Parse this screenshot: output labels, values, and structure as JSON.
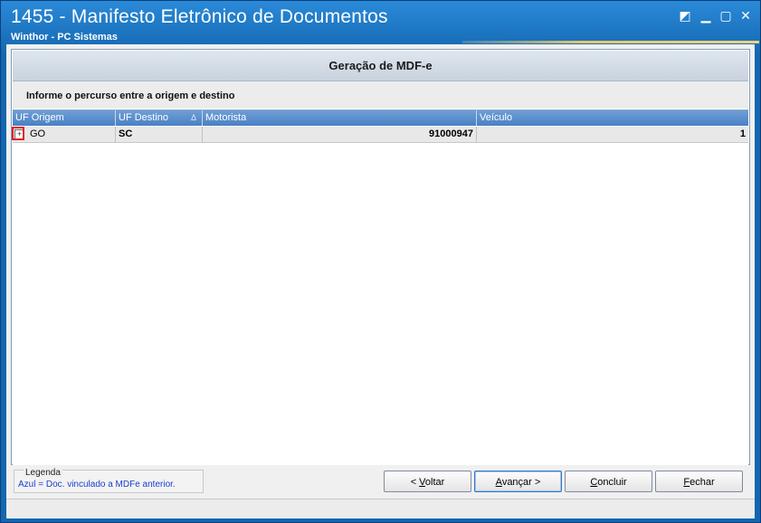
{
  "window": {
    "title": "1455 - Manifesto Eletrônico de Documentos",
    "subtitle": "Winthor - PC Sistemas",
    "controls": {
      "restore_glyph": "◩",
      "minimize_glyph": "▁",
      "maximize_glyph": "▢",
      "close_glyph": "✕"
    }
  },
  "panel": {
    "title": "Geração de MDF-e",
    "instruction": "Informe o percurso entre a origem e destino"
  },
  "grid": {
    "columns": [
      "UF Origem",
      "UF Destino",
      "Motorista",
      "Veículo"
    ],
    "sort_glyph": "Δ",
    "rows": [
      {
        "uf_origem": "GO",
        "uf_destino": "SC",
        "motorista": "91000947",
        "veiculo": "1",
        "expand_glyph": "+"
      }
    ]
  },
  "legend": {
    "title": "Legenda",
    "text": "Azul = Doc. vinculado a MDFe anterior."
  },
  "buttons": {
    "voltar": {
      "prefix": "< ",
      "accel": "V",
      "rest": "oltar"
    },
    "avancar": {
      "prefix": "",
      "accel": "A",
      "rest": "vançar >"
    },
    "concluir": {
      "prefix": "",
      "accel": "C",
      "rest": "oncluir"
    },
    "fechar": {
      "prefix": "",
      "accel": "F",
      "rest": "echar"
    }
  },
  "colors": {
    "title_bar": "#1466b0",
    "grid_header": "#4a80c4",
    "highlight": "#e0202a",
    "legend_text": "#1a3fcc"
  }
}
